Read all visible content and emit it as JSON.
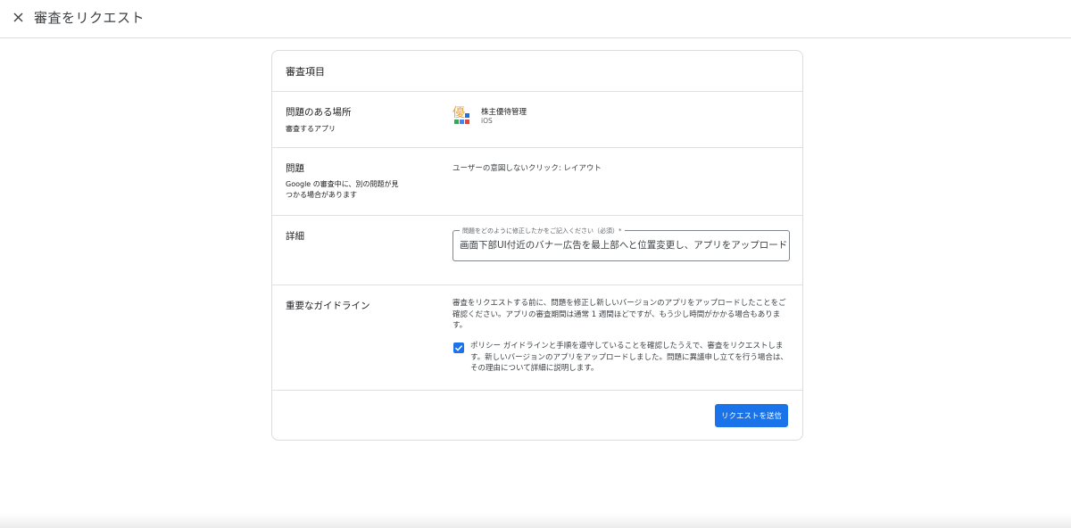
{
  "header": {
    "title": "審査をリクエスト"
  },
  "card": {
    "title": "審査項目",
    "location": {
      "label": "問題のある場所",
      "sub": "審査するアプリ",
      "app_name": "株主優待管理",
      "platform": "iOS",
      "icon_glyph": "優"
    },
    "issue": {
      "label": "問題",
      "sub": "Google の審査中に、別の問題が見つかる場合があります",
      "value": "ユーザーの意図しないクリック: レイアウト"
    },
    "details": {
      "label": "詳細",
      "field_label": "問題をどのように修正したかをご記入ください（必須）*",
      "field_value": "画面下部UI付近のバナー広告を最上部へと位置変更し、アプリをアップロードし"
    },
    "guidelines": {
      "label": "重要なガイドライン",
      "text": "審査をリクエストする前に、問題を修正し新しいバージョンのアプリをアップロードしたことをご確認ください。アプリの審査期間は通常 1 週間ほどですが、もう少し時間がかかる場合もあります。",
      "checkbox_text": "ポリシー ガイドラインと手順を遵守していることを確認したうえで、審査をリクエストします。新しいバージョンのアプリをアップロードしました。問題に異議申し立てを行う場合は、その理由について詳細に説明します。",
      "checked": true
    },
    "submit_label": "リクエストを送信"
  },
  "colors": {
    "accent": "#1a73e8",
    "border": "#dadce0",
    "text": "#202124"
  }
}
